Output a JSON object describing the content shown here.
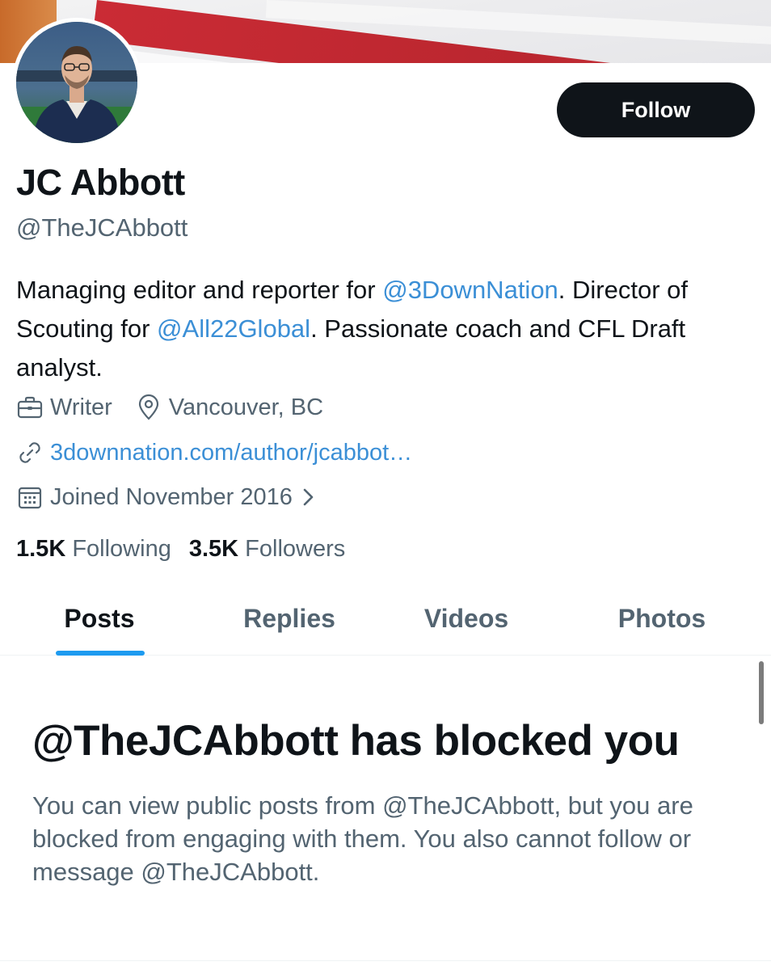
{
  "profile": {
    "name": "JC Abbott",
    "handle": "@TheJCAbbott",
    "follow_label": "Follow",
    "bio": {
      "part1": "Managing editor and reporter for ",
      "mention1": "@3DownNation",
      "part2": ". Director of Scouting for ",
      "mention2": "@All22Global",
      "part3": ". Passionate coach and CFL Draft analyst."
    },
    "profession": "Writer",
    "location": "Vancouver, BC",
    "website": "3downnation.com/author/jcabbot…",
    "joined": "Joined November 2016",
    "stats": {
      "following_count": "1.5K",
      "following_label": "Following",
      "followers_count": "3.5K",
      "followers_label": "Followers"
    }
  },
  "tabs": [
    {
      "label": "Posts",
      "active": true
    },
    {
      "label": "Replies",
      "active": false
    },
    {
      "label": "Videos",
      "active": false
    },
    {
      "label": "Photos",
      "active": false
    }
  ],
  "blocked": {
    "title": "@TheJCAbbott has blocked you",
    "message": "You can view public posts from @TheJCAbbott, but you are blocked from engaging with them. You also cannot follow or message @TheJCAbbott."
  },
  "icons": {
    "profession": "briefcase-icon",
    "location": "location-pin-icon",
    "website": "link-icon",
    "joined": "calendar-icon",
    "joined_chevron": "chevron-right-icon"
  },
  "colors": {
    "text_primary": "#0f1419",
    "text_secondary": "#536471",
    "link": "#3b8fd6",
    "accent": "#1d9bf0",
    "button_bg": "#0f1419"
  }
}
